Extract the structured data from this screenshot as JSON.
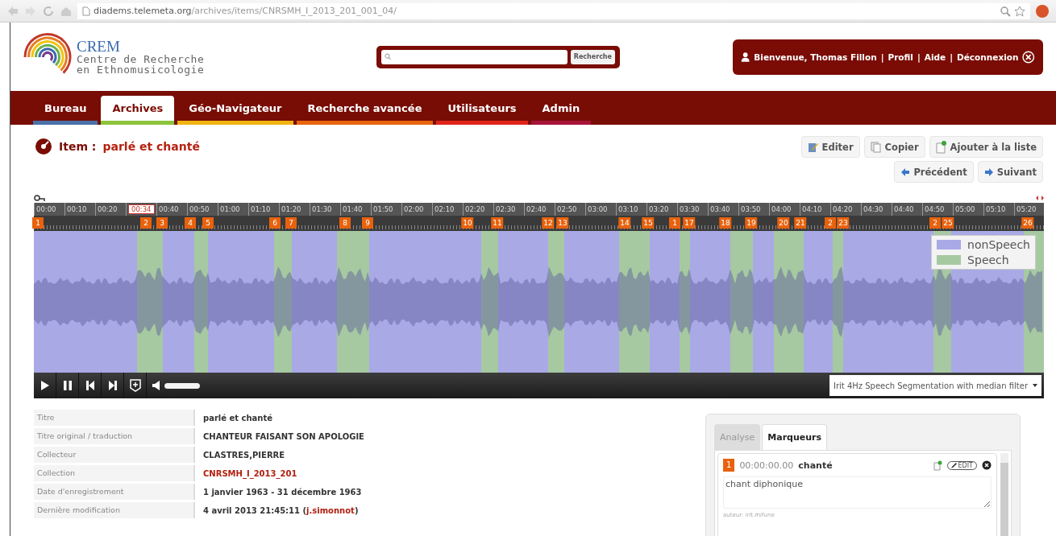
{
  "browser": {
    "url_domain": "diadems.telemeta.org",
    "url_path": "/archives/items/CNRSMH_I_2013_201_001_04/"
  },
  "header": {
    "logo": {
      "name": "CREM",
      "line_1": "Centre de Recherche",
      "line_2": "en Ethnomusicologie"
    },
    "search_button": "Recherche",
    "user": {
      "greeting": "Bienvenue, Thomas Fillon",
      "separator": "|",
      "links": [
        "Profil",
        "Aide",
        "Déconnexion"
      ]
    }
  },
  "nav": [
    {
      "label": "Bureau",
      "selected": false,
      "color": "#4a72a8"
    },
    {
      "label": "Archives",
      "selected": true,
      "color": "#8cc43c"
    },
    {
      "label": "Géo-Navigateur",
      "selected": false,
      "color": "#f0b412"
    },
    {
      "label": "Recherche avancée",
      "selected": false,
      "color": "#e8640e"
    },
    {
      "label": "Utilisateurs",
      "selected": false,
      "color": "#e0241a"
    },
    {
      "label": "Admin",
      "selected": false,
      "color": "#a8143a"
    }
  ],
  "item": {
    "label": "Item :",
    "title": "parlé et chanté"
  },
  "actions": [
    {
      "label": "Editer",
      "kind": "edit"
    },
    {
      "label": "Copier",
      "kind": "copy"
    },
    {
      "label": "Ajouter à la liste",
      "kind": "add"
    }
  ],
  "navigation": [
    {
      "label": "Précédent",
      "kind": "previous"
    },
    {
      "label": "Suivant",
      "kind": "next"
    }
  ],
  "player": {
    "ruler": [
      {
        "label": "00:00",
        "current": false
      },
      {
        "label": "00:10",
        "current": false
      },
      {
        "label": "00:20",
        "current": false
      },
      {
        "label": "00:34",
        "current": true
      },
      {
        "label": "00:40",
        "current": false
      },
      {
        "label": "00:50",
        "current": false
      },
      {
        "label": "01:00",
        "current": false
      },
      {
        "label": "01:10",
        "current": false
      },
      {
        "label": "01:20",
        "current": false
      },
      {
        "label": "01:30",
        "current": false
      },
      {
        "label": "01:40",
        "current": false
      },
      {
        "label": "01:50",
        "current": false
      },
      {
        "label": "02:00",
        "current": false
      },
      {
        "label": "02:10",
        "current": false
      },
      {
        "label": "02:20",
        "current": false
      },
      {
        "label": "02:30",
        "current": false
      },
      {
        "label": "02:40",
        "current": false
      },
      {
        "label": "02:50",
        "current": false
      },
      {
        "label": "03:00",
        "current": false
      },
      {
        "label": "03:10",
        "current": false
      },
      {
        "label": "03:20",
        "current": false
      },
      {
        "label": "03:30",
        "current": false
      },
      {
        "label": "03:40",
        "current": false
      },
      {
        "label": "03:50",
        "current": false
      },
      {
        "label": "04:00",
        "current": false
      },
      {
        "label": "04:10",
        "current": false
      },
      {
        "label": "04:20",
        "current": false
      },
      {
        "label": "04:30",
        "current": false
      },
      {
        "label": "04:40",
        "current": false
      },
      {
        "label": "04:50",
        "current": false
      },
      {
        "label": "05:00",
        "current": false
      },
      {
        "label": "05:10",
        "current": false
      },
      {
        "label": "05:20",
        "current": false
      }
    ],
    "markers": [
      "1",
      "2",
      "3",
      "4",
      "5",
      "6",
      "7",
      "8",
      "9",
      "10",
      "11",
      "12",
      "13",
      "14",
      "15",
      "1",
      "17",
      "18",
      "19",
      "20",
      "21",
      "2",
      "23",
      "2",
      "25",
      "26"
    ],
    "legend": [
      {
        "label": "nonSpeech",
        "color": "#a9a9e6"
      },
      {
        "label": "Speech",
        "color": "#a6c9a2"
      }
    ],
    "volume": {
      "level": 1
    },
    "analysis": "Irit 4Hz Speech Segmentation with median filter"
  },
  "metadata": [
    {
      "label": "Titre",
      "parts": [
        {
          "text": "parlé et chanté",
          "link": false
        }
      ]
    },
    {
      "label": "Titre original / traduction",
      "parts": [
        {
          "text": "CHANTEUR FAISANT SON APOLOGIE",
          "link": false
        }
      ]
    },
    {
      "label": "Collecteur",
      "parts": [
        {
          "text": "CLASTRES,PIERRE",
          "link": false
        }
      ]
    },
    {
      "label": "Collection",
      "parts": [
        {
          "text": "CNRSMH_I_2013_201",
          "link": true
        }
      ]
    },
    {
      "label": "Date d'enregistrement",
      "parts": [
        {
          "text": "1 janvier 1963 - 31 décembre 1963",
          "link": false
        }
      ]
    },
    {
      "label": "Dernière modification",
      "parts": [
        {
          "text": "4 avril 2013 21:45:11 (",
          "link": false
        },
        {
          "text": "j.simonnot",
          "link": true
        },
        {
          "text": ")",
          "link": false
        }
      ]
    }
  ],
  "panel": {
    "tabs": [
      {
        "label": "Analyse",
        "selected": false
      },
      {
        "label": "Marqueurs",
        "selected": true
      }
    ],
    "marker": {
      "number": "1",
      "time": "00:00:00.00",
      "title": "chanté",
      "edit": "EDIT",
      "description": "chant diphonique",
      "author": "auteur: irit.mifune"
    }
  }
}
